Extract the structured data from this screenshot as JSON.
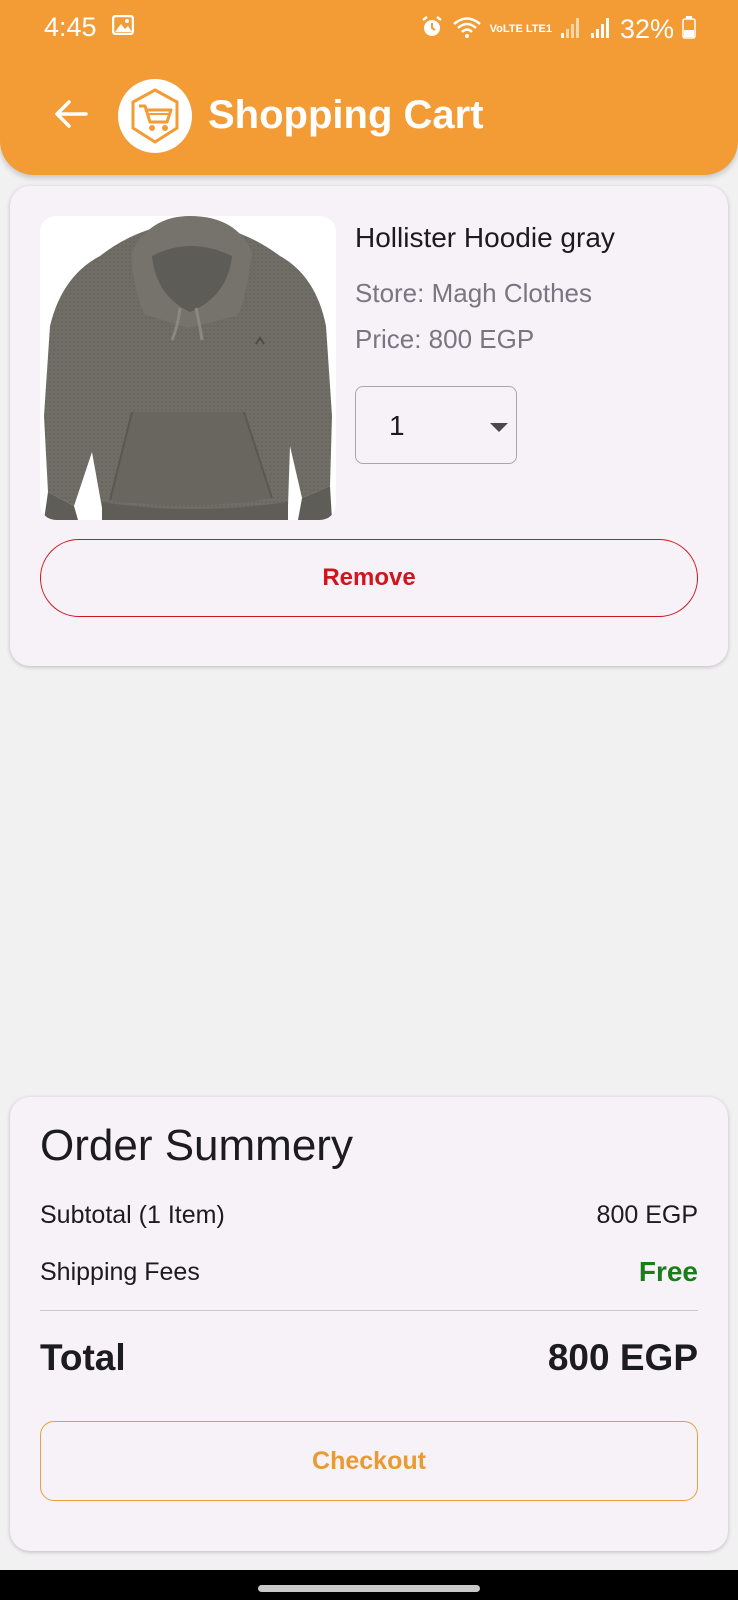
{
  "status_bar": {
    "time": "4:45",
    "battery_percent": "32%",
    "network_label": "VoLTE LTE1"
  },
  "header": {
    "title": "Shopping Cart",
    "back_icon": "arrow-back-icon",
    "logo_icon": "shopping-cart-logo"
  },
  "cart": {
    "items": [
      {
        "name": "Hollister Hoodie gray",
        "store": "Store: Magh Clothes",
        "price": "Price: 800 EGP",
        "quantity": "1",
        "remove_label": "Remove",
        "image_icon": "gray-hoodie-image"
      }
    ]
  },
  "summary": {
    "title": "Order Summery",
    "subtotal_label": "Subtotal (1 Item)",
    "subtotal_value": "800 EGP",
    "shipping_label": "Shipping Fees",
    "shipping_value": "Free",
    "total_label": "Total",
    "total_value": "800 EGP",
    "checkout_label": "Checkout"
  },
  "colors": {
    "brand_orange": "#f39b34",
    "remove_red": "#d0161d",
    "free_green": "#1a7d1a",
    "checkout_orange": "#e89a33"
  }
}
